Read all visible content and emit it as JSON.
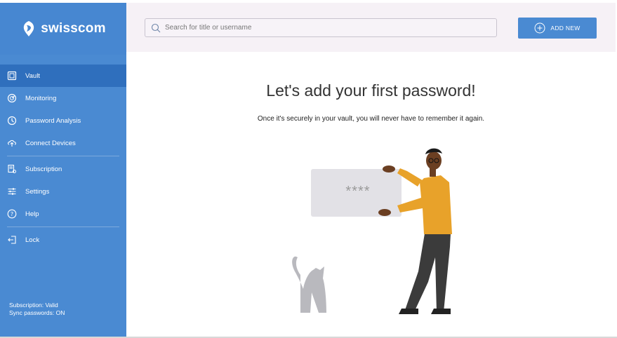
{
  "brand": {
    "name": "swisscom"
  },
  "search": {
    "placeholder": "Search for title or username"
  },
  "toolbar": {
    "add_label": "ADD NEW"
  },
  "sidebar": {
    "items": [
      {
        "label": "Vault",
        "icon": "vault-icon",
        "active": true
      },
      {
        "label": "Monitoring",
        "icon": "monitoring-icon"
      },
      {
        "label": "Password Analysis",
        "icon": "analysis-icon"
      },
      {
        "label": "Connect Devices",
        "icon": "connect-devices-icon"
      },
      {
        "label": "Subscription",
        "icon": "subscription-icon"
      },
      {
        "label": "Settings",
        "icon": "settings-sliders-icon"
      },
      {
        "label": "Help",
        "icon": "help-icon"
      },
      {
        "label": "Lock",
        "icon": "lock-icon"
      }
    ],
    "status": {
      "subscription": "Subscription: Valid",
      "sync": "Sync passwords: ON"
    }
  },
  "main": {
    "title": "Let's add your first password!",
    "subtitle": "Once it's securely in your vault, you will never have to remember it again.",
    "card_text": "****"
  },
  "colors": {
    "sidebar": "#4a8ad2",
    "active_item": "#2f6fbd",
    "header_bg": "#f6f1f6",
    "accent": "#4a8ad2",
    "sweater": "#e8a22a"
  }
}
